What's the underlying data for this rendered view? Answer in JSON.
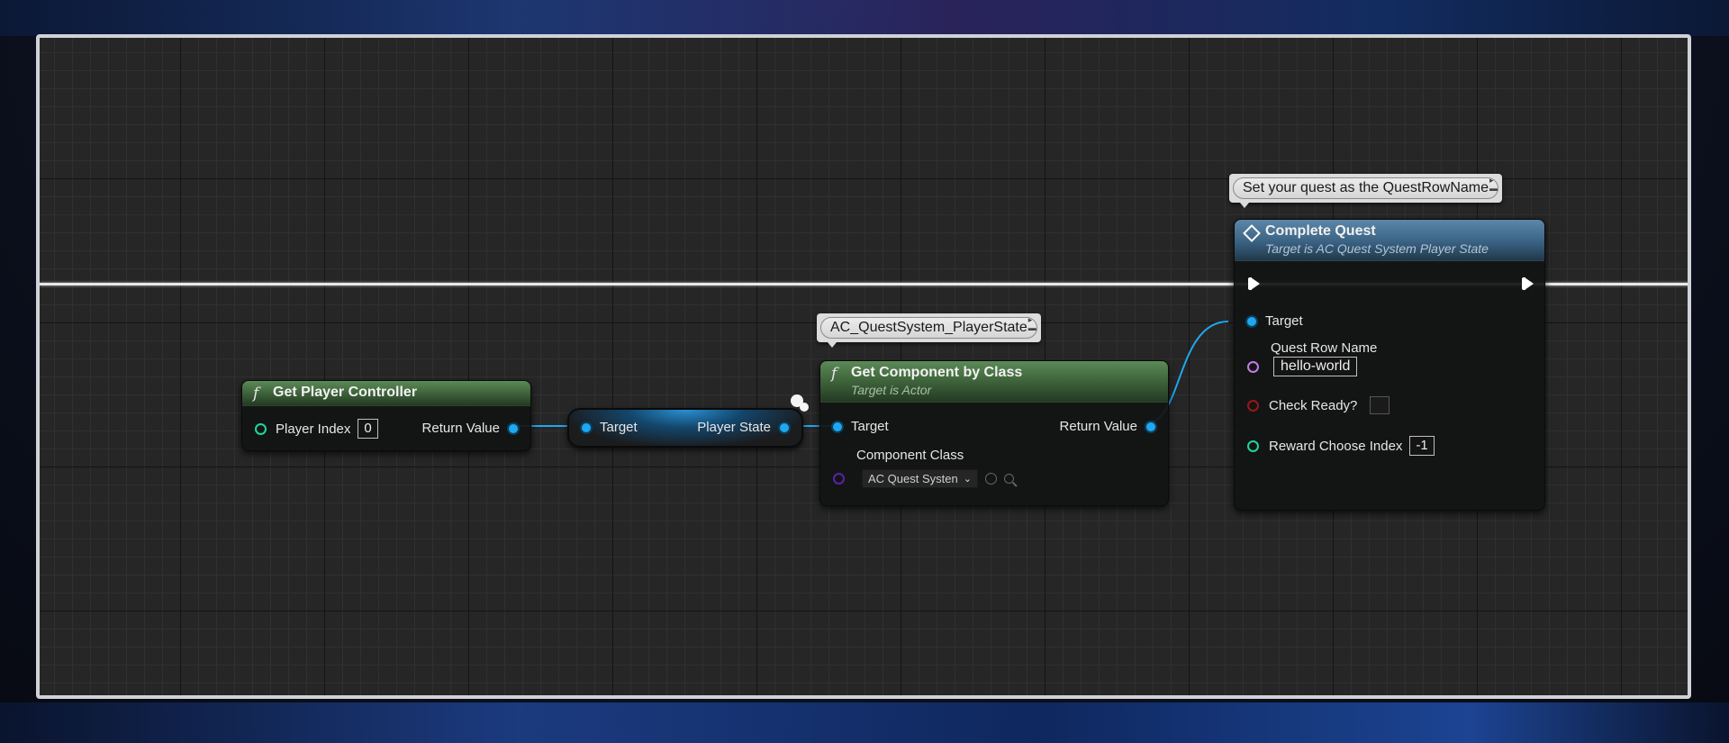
{
  "comments": {
    "complete_quest": "Set your quest as the QuestRowName",
    "get_component": "AC_QuestSystem_PlayerState"
  },
  "nodes": {
    "get_player_controller": {
      "title": "Get Player Controller",
      "pins": {
        "player_index": "Player Index",
        "player_index_value": "0",
        "return_value": "Return Value"
      }
    },
    "get_player_state": {
      "pins": {
        "target": "Target",
        "player_state": "Player State"
      }
    },
    "get_component_by_class": {
      "title": "Get Component by Class",
      "subtitle": "Target is Actor",
      "pins": {
        "target": "Target",
        "return_value": "Return Value",
        "component_class": "Component Class",
        "component_class_value": "AC Quest Systen"
      }
    },
    "complete_quest": {
      "title": "Complete Quest",
      "subtitle": "Target is AC Quest System Player State",
      "pins": {
        "target": "Target",
        "quest_row_name": "Quest Row Name",
        "quest_row_name_value": "hello-world",
        "check_ready": "Check Ready?",
        "reward_choose_index": "Reward Choose Index",
        "reward_choose_index_value": "-1"
      }
    }
  },
  "colors": {
    "object_pin": "#1fa8f0",
    "int_pin": "#1dd6a0",
    "name_pin": "#c77be6",
    "bool_pin": "#9c1616",
    "class_pin": "#5a22a8",
    "exec_wire": "#e9e9e9"
  },
  "icons": [
    "function-icon",
    "event-diamond-icon",
    "exec-pin-icon",
    "pin-icon",
    "chevron-down-icon",
    "use-selected-icon",
    "browse-search-icon",
    "comment-pin-icon"
  ]
}
